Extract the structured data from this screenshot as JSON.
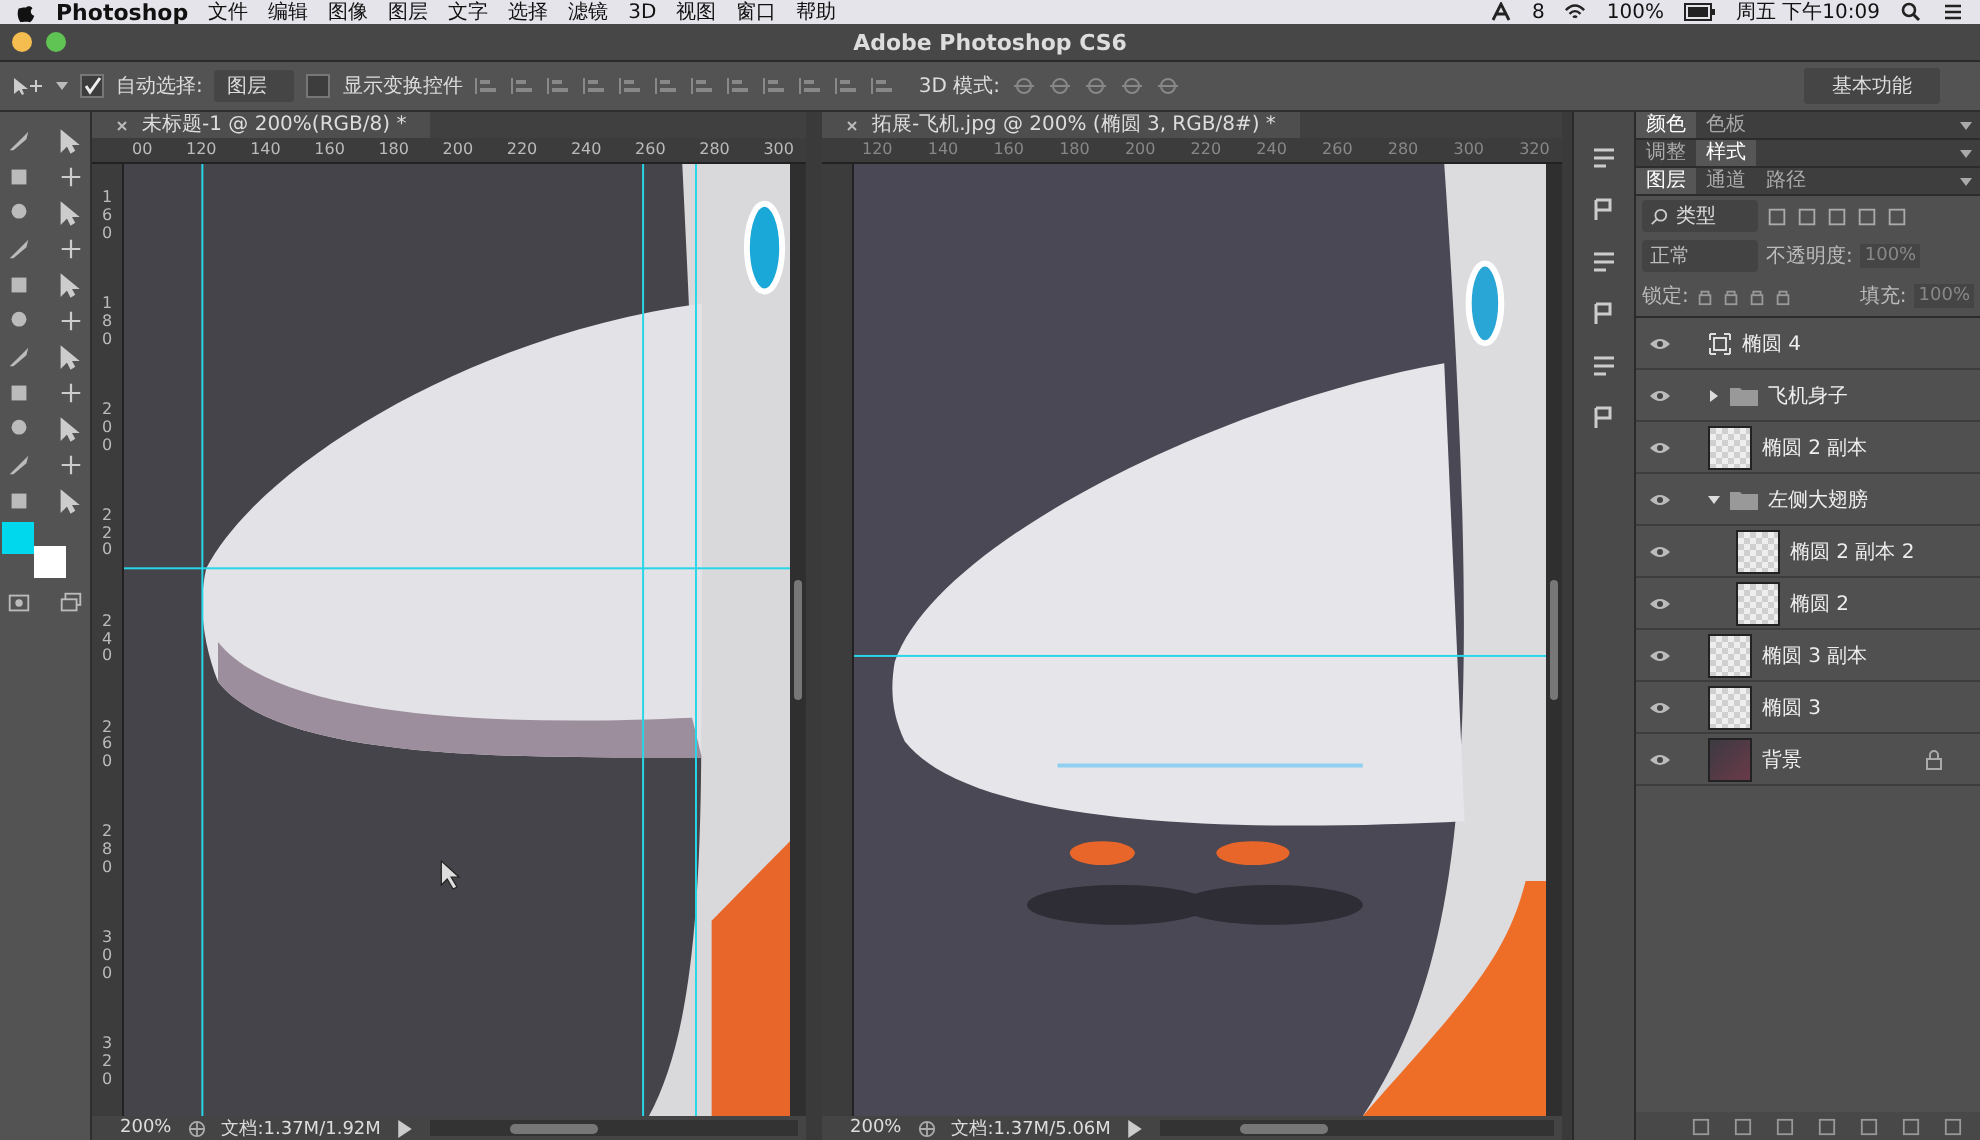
{
  "menubar": {
    "app": "Photoshop",
    "items": [
      "文件",
      "编辑",
      "图像",
      "图层",
      "文字",
      "选择",
      "滤镜",
      "3D",
      "视图",
      "窗口",
      "帮助"
    ],
    "notification_count": "8",
    "battery": "100%",
    "clock": "周五 下午10:09"
  },
  "window": {
    "title": "Adobe Photoshop CS6"
  },
  "options_bar": {
    "auto_select": {
      "label": "自动选择:",
      "checked": true
    },
    "auto_select_target": "图层",
    "show_transform": {
      "label": "显示变换控件",
      "checked": false
    },
    "mode_3d": "3D 模式:",
    "workspace": "基本功能"
  },
  "swatches": [
    {
      "kind": "foreground",
      "color": "#00d8ee"
    },
    {
      "kind": "background",
      "color": "#ffffff"
    }
  ],
  "documents": [
    {
      "tab": "未标题-1 @ 200%(RGB/8) *",
      "ruler": [
        "00",
        "120",
        "140",
        "160",
        "180",
        "200",
        "220",
        "240",
        "260",
        "280",
        "300"
      ],
      "vruler": [
        "160",
        "180",
        "200",
        "220",
        "240",
        "260",
        "280",
        "300",
        "320"
      ],
      "zoom": "200%",
      "doc_info": "文档:1.37M/1.92M"
    },
    {
      "tab": "拓展-飞机.jpg @ 200% (椭圆 3, RGB/8#) *",
      "ruler": [
        "120",
        "140",
        "160",
        "180",
        "200",
        "220",
        "240",
        "260",
        "280",
        "300",
        "320"
      ],
      "zoom": "200%",
      "doc_info": "文档:1.37M/5.06M"
    }
  ],
  "panels": {
    "tab_groups": [
      [
        {
          "label": "颜色",
          "selected": true
        },
        {
          "label": "色板",
          "selected": false
        }
      ],
      [
        {
          "label": "调整",
          "selected": false
        },
        {
          "label": "样式",
          "selected": true
        }
      ],
      [
        {
          "label": "图层",
          "selected": true
        },
        {
          "label": "通道",
          "selected": false
        },
        {
          "label": "路径",
          "selected": false
        }
      ]
    ],
    "filter": "类型",
    "blend_mode": "正常",
    "opacity_label": "不透明度:",
    "opacity": "100%",
    "lock_label": "锁定:",
    "fill_label": "填充:",
    "fill": "100%",
    "layers": [
      {
        "name": "椭圆 4",
        "kind": "shape",
        "visible": true
      },
      {
        "name": "飞机身子",
        "kind": "group",
        "visible": true,
        "expanded": false
      },
      {
        "name": "椭圆 2 副本",
        "kind": "pixel",
        "visible": true
      },
      {
        "name": "左侧大翅膀",
        "kind": "group",
        "visible": true,
        "expanded": true,
        "children": [
          {
            "name": "椭圆 2 副本 2",
            "kind": "pixel",
            "visible": true
          },
          {
            "name": "椭圆 2",
            "kind": "pixel",
            "visible": true
          }
        ]
      },
      {
        "name": "椭圆 3 副本",
        "kind": "pixel",
        "visible": true
      },
      {
        "name": "椭圆 3",
        "kind": "pixel",
        "visible": true
      },
      {
        "name": "背景",
        "kind": "background",
        "visible": true,
        "locked": true
      }
    ]
  }
}
